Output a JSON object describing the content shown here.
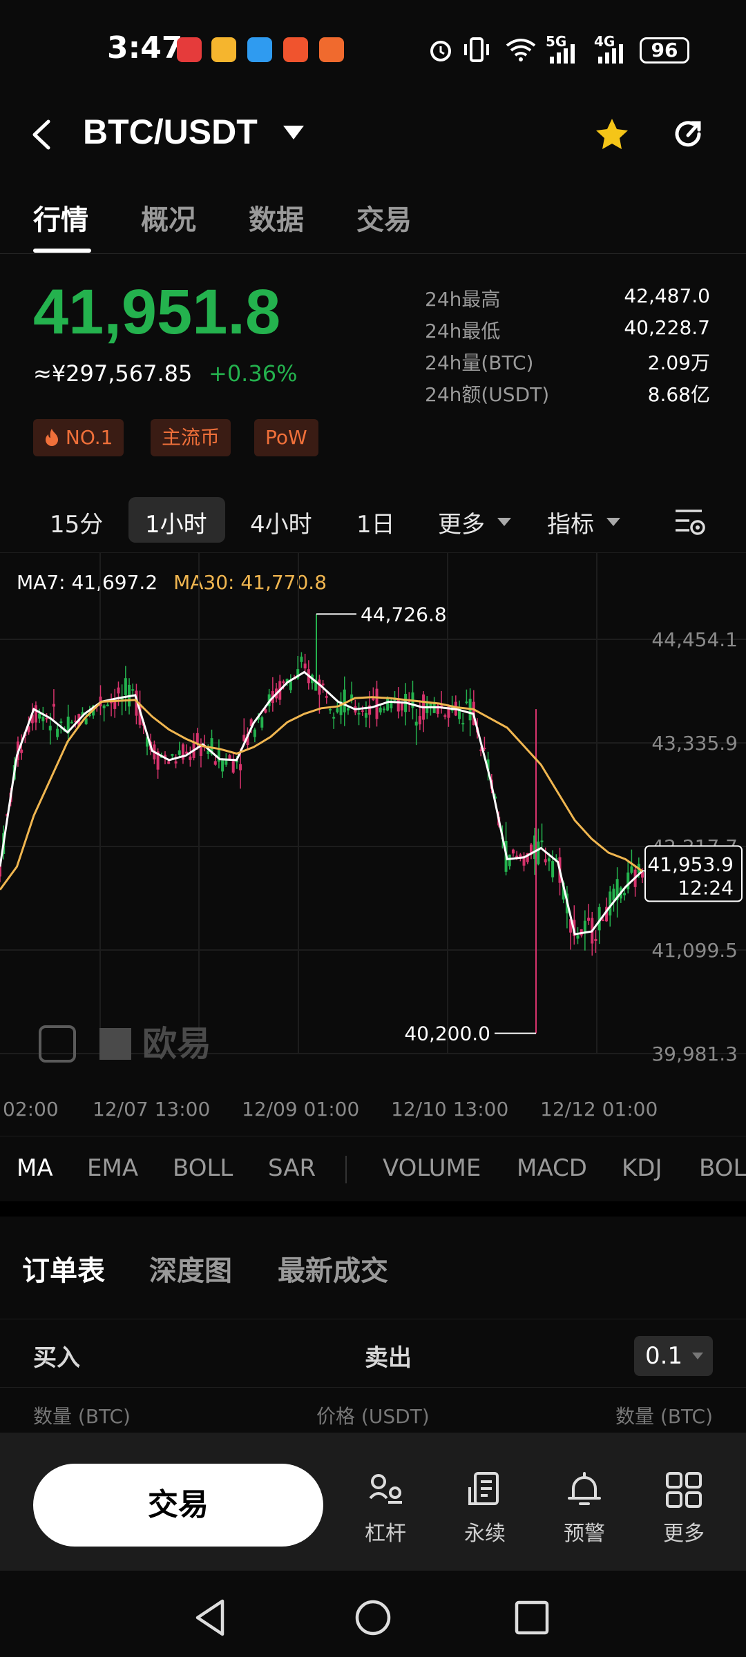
{
  "status_bar": {
    "time": "3:47",
    "battery": "96",
    "network_5g": "5G",
    "network_4g": "4G"
  },
  "header": {
    "pair": "BTC/USDT"
  },
  "tabs": [
    {
      "label": "行情"
    },
    {
      "label": "概况"
    },
    {
      "label": "数据"
    },
    {
      "label": "交易"
    }
  ],
  "ticker": {
    "price": "41,951.8",
    "price_cny": "≈¥297,567.85",
    "change": "+0.36%",
    "badges": [
      "NO.1",
      "主流币",
      "PoW"
    ],
    "stats": [
      {
        "label": "24h最高",
        "value": "42,487.0"
      },
      {
        "label": "24h最低",
        "value": "40,228.7"
      },
      {
        "label": "24h量(BTC)",
        "value": "2.09万"
      },
      {
        "label": "24h额(USDT)",
        "value": "8.68亿"
      }
    ]
  },
  "intervals": [
    {
      "label": "15分"
    },
    {
      "label": "1小时"
    },
    {
      "label": "4小时"
    },
    {
      "label": "1日"
    },
    {
      "label": "更多"
    },
    {
      "label": "指标"
    }
  ],
  "chart_data": {
    "type": "line",
    "ma_legend": {
      "ma7": "MA7: 41,697.2",
      "ma30": "MA30: 41,770.8"
    },
    "y_ticks": [
      "44,454.1",
      "43,335.9",
      "42,217.7",
      "41,099.5",
      "39,981.3"
    ],
    "ylim": [
      39981.3,
      44454.1
    ],
    "x_ticks": [
      "02:00",
      "12/07 13:00",
      "12/09 01:00",
      "12/10 13:00",
      "12/12 01:00"
    ],
    "high_label": "44,726.8",
    "low_label": "40,200.0",
    "current_price": "41,953.9",
    "countdown": "12:24",
    "watermark": "欧易",
    "colors": {
      "up": "#24b24e",
      "down": "#d6336c",
      "ma7": "#ffffff",
      "ma30": "#f0b650"
    },
    "series": [
      {
        "name": "MA7",
        "values": [
          42000,
          43200,
          43700,
          43600,
          43450,
          43650,
          43780,
          43820,
          43850,
          43250,
          43150,
          43200,
          43320,
          43160,
          43150,
          43550,
          43800,
          43990,
          44100,
          43950,
          43780,
          43700,
          43720,
          43780,
          43770,
          43720,
          43720,
          43700,
          43650,
          42950,
          42080,
          42100,
          42200,
          42050,
          41270,
          41300,
          41550,
          41780,
          41953.9
        ]
      },
      {
        "name": "MA30",
        "values": [
          41750,
          42000,
          42550,
          42950,
          43350,
          43600,
          43780,
          43790,
          43800,
          43620,
          43480,
          43380,
          43300,
          43270,
          43220,
          43290,
          43400,
          43560,
          43650,
          43710,
          43730,
          43820,
          43830,
          43820,
          43800,
          43780,
          43760,
          43720,
          43700,
          43600,
          43500,
          43300,
          43100,
          42800,
          42500,
          42300,
          42150,
          42080,
          41950
        ]
      }
    ]
  },
  "indicators": [
    {
      "label": "MA"
    },
    {
      "label": "EMA"
    },
    {
      "label": "BOLL"
    },
    {
      "label": "SAR"
    },
    {
      "label": "VOLUME"
    },
    {
      "label": "MACD"
    },
    {
      "label": "KDJ"
    },
    {
      "label": "BOL"
    }
  ],
  "orderbook": {
    "tabs": [
      "订单表",
      "深度图",
      "最新成交"
    ],
    "buy": "买入",
    "sell": "卖出",
    "precision": "0.1",
    "col_qty_left": "数量 (BTC)",
    "col_price": "价格 (USDT)",
    "col_qty_right": "数量 (BTC)"
  },
  "bottom_bar": {
    "trade": "交易",
    "nav": [
      {
        "label": "杠杆",
        "icon": "leverage-icon"
      },
      {
        "label": "永续",
        "icon": "perpetual-icon"
      },
      {
        "label": "预警",
        "icon": "bell-icon"
      },
      {
        "label": "更多",
        "icon": "grid-icon"
      }
    ]
  }
}
